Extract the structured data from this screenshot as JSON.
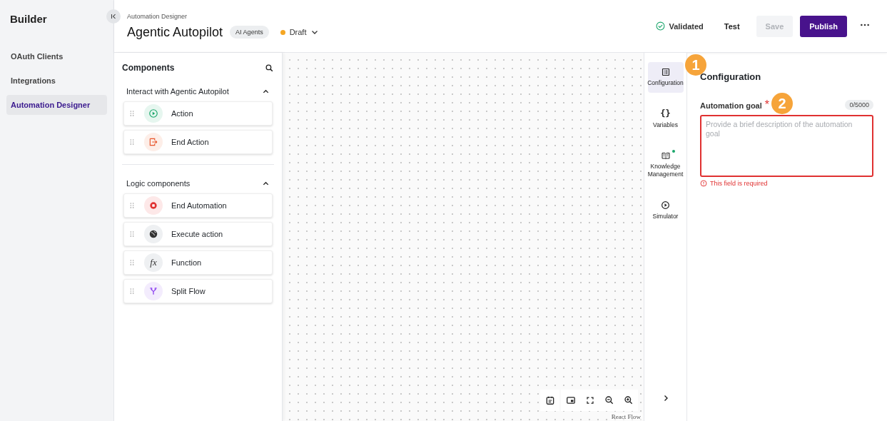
{
  "sidebar": {
    "title": "Builder",
    "items": [
      {
        "label": "OAuth Clients",
        "selected": false
      },
      {
        "label": "Integrations",
        "selected": false
      },
      {
        "label": "Automation Designer",
        "selected": true
      }
    ]
  },
  "header": {
    "breadcrumb": "Automation Designer",
    "title": "Agentic Autopilot",
    "tag": "AI Agents",
    "status": {
      "label": "Draft",
      "color": "#f5a623"
    },
    "validation": "Validated",
    "actions": [
      {
        "label": "Test",
        "kind": "text",
        "disabled": false
      },
      {
        "label": "Save",
        "kind": "secondary",
        "disabled": true
      },
      {
        "label": "Publish",
        "kind": "primary",
        "disabled": false
      }
    ]
  },
  "components": {
    "title": "Components",
    "groups": [
      {
        "title": "Interact with Agentic Autopilot",
        "expanded": true,
        "items": [
          {
            "label": "Action",
            "kind": "action"
          },
          {
            "label": "End Action",
            "kind": "end-action"
          }
        ]
      },
      {
        "title": "Logic components",
        "expanded": true,
        "items": [
          {
            "label": "End Automation",
            "kind": "end-automation"
          },
          {
            "label": "Execute action",
            "kind": "execute"
          },
          {
            "label": "Function",
            "kind": "function",
            "glyph": "fx"
          },
          {
            "label": "Split Flow",
            "kind": "split"
          }
        ]
      }
    ]
  },
  "canvas": {
    "attribution": "React Flow"
  },
  "side_tabs": [
    {
      "label": "Configuration",
      "kind": "config",
      "selected": true,
      "indicator": false
    },
    {
      "label": "Variables",
      "kind": "variables",
      "glyph": "{}",
      "selected": false,
      "indicator": false
    },
    {
      "label": "Knowledge Management",
      "kind": "book",
      "selected": false,
      "indicator": true
    },
    {
      "label": "Simulator",
      "kind": "play",
      "selected": false,
      "indicator": false
    }
  ],
  "config": {
    "title": "Configuration",
    "field": {
      "label": "Automation goal",
      "required_mark": "*",
      "counter": "0/5000",
      "placeholder": "Provide a brief description of the automation goal",
      "error": "This field is required"
    }
  },
  "callouts": [
    {
      "number": "1"
    },
    {
      "number": "2"
    }
  ]
}
